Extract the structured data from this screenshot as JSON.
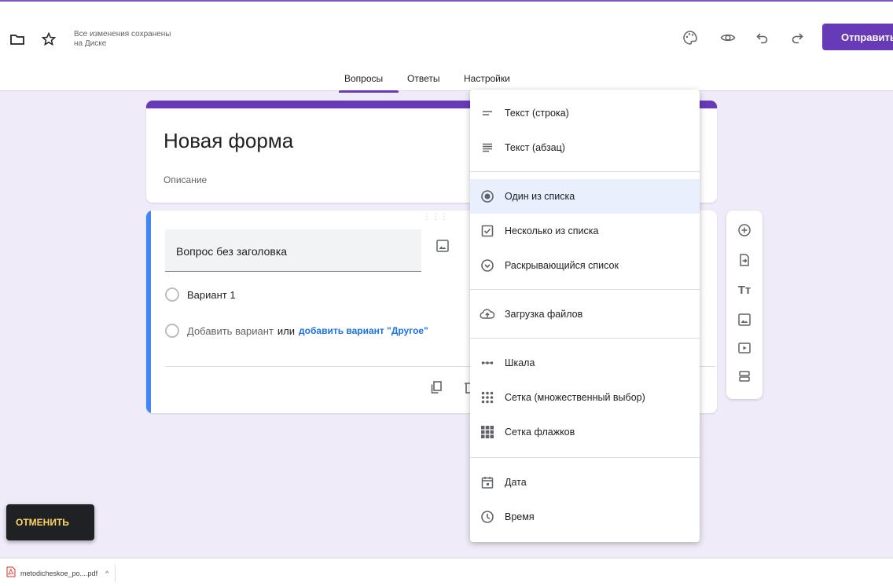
{
  "header": {
    "save_status_line1": "Все изменения сохранены",
    "save_status_line2": "на Диске",
    "send_label": "Отправить",
    "icons": [
      "folder-icon",
      "star-icon",
      "palette-icon",
      "eye-icon",
      "undo-icon",
      "redo-icon"
    ]
  },
  "tabs": [
    {
      "label": "Вопросы",
      "active": true
    },
    {
      "label": "Ответы",
      "active": false
    },
    {
      "label": "Настройки",
      "active": false
    }
  ],
  "form": {
    "title": "Новая форма",
    "description_placeholder": "Описание"
  },
  "question": {
    "title_placeholder": "Вопрос без заголовка",
    "option1": "Вариант 1",
    "add_option": "Добавить вариант",
    "or": "или",
    "add_other": "добавить вариант \"Другое\""
  },
  "menu": {
    "items": [
      {
        "label": "Текст (строка)",
        "icon": "short-text-icon"
      },
      {
        "label": "Текст (абзац)",
        "icon": "paragraph-icon"
      },
      {
        "label": "Один из списка",
        "icon": "radio-button-icon",
        "selected": true
      },
      {
        "label": "Несколько из списка",
        "icon": "checkbox-icon"
      },
      {
        "label": "Раскрывающийся список",
        "icon": "dropdown-icon"
      },
      {
        "label": "Загрузка файлов",
        "icon": "cloud-upload-icon"
      },
      {
        "label": "Шкала",
        "icon": "linear-scale-icon"
      },
      {
        "label": "Сетка (множественный выбор)",
        "icon": "grid-icon"
      },
      {
        "label": "Сетка флажков",
        "icon": "checkbox-grid-icon"
      },
      {
        "label": "Дата",
        "icon": "calendar-icon"
      },
      {
        "label": "Время",
        "icon": "clock-icon"
      }
    ]
  },
  "side_toolbar": {
    "icons": [
      "add-question-icon",
      "import-question-icon",
      "add-title-icon",
      "add-image-icon",
      "add-video-icon",
      "add-section-icon"
    ],
    "title_glyph": "Tт"
  },
  "snackbar": {
    "action_label": "ОТМЕНИТЬ"
  },
  "download": {
    "filename": "metodicheskoe_po....pdf",
    "chevron": "^"
  },
  "colors": {
    "accent": "#673ab7",
    "background": "#f0ebf8",
    "question_focus": "#4285f4",
    "link": "#1a73e8",
    "menu_selected": "#e8f0fe"
  }
}
